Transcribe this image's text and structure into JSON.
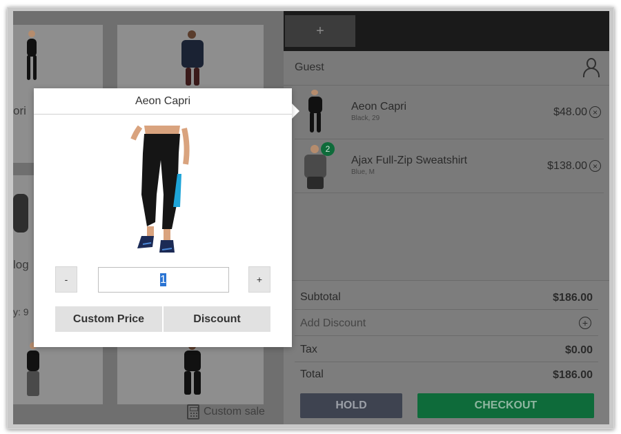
{
  "grid": {
    "partial_labels": [
      "ori",
      "log",
      "y: 9"
    ],
    "custom_sale_label": "Custom sale"
  },
  "cart": {
    "add_tab_label": "+",
    "customer": "Guest",
    "items": [
      {
        "name": "Aeon Capri",
        "options": "Black, 29",
        "price": "$48.00",
        "qty_badge": ""
      },
      {
        "name": "Ajax Full-Zip Sweatshirt",
        "options": "Blue, M",
        "price": "$138.00",
        "qty_badge": "2"
      }
    ],
    "totals": {
      "subtotal_label": "Subtotal",
      "subtotal_value": "$186.00",
      "discount_label": "Add Discount",
      "tax_label": "Tax",
      "tax_value": "$0.00",
      "total_label": "Total",
      "total_value": "$186.00"
    },
    "hold_label": "HOLD",
    "checkout_label": "CHECKOUT"
  },
  "modal": {
    "title": "Aeon Capri",
    "minus_label": "-",
    "plus_label": "+",
    "qty_value": "1",
    "custom_price_label": "Custom Price",
    "discount_label": "Discount"
  },
  "colors": {
    "checkout": "#0e6b3a",
    "hold": "#3e4350",
    "selection": "#2a74d3"
  }
}
